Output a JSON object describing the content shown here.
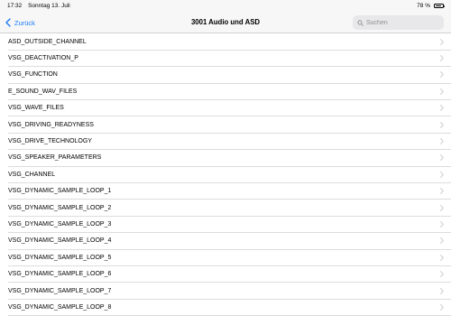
{
  "status": {
    "time": "17:32",
    "date": "Sonntag 13. Juli",
    "battery": "78 %",
    "battery_level": 0.78
  },
  "nav": {
    "back_label": "Zurück",
    "title": "3001 Audio und ASD",
    "search_placeholder": "Suchen"
  },
  "items": [
    "ASD_OUTSIDE_CHANNEL",
    "VSG_DEACTIVATION_P",
    "VSG_FUNCTION",
    "E_SOUND_WAV_FILES",
    "VSG_WAVE_FILES",
    "VSG_DRIVING_READYNESS",
    "VSG_DRIVE_TECHNOLOGY",
    "VSG_SPEAKER_PARAMETERS",
    "VSG_CHANNEL",
    "VSG_DYNAMIC_SAMPLE_LOOP_1",
    "VSG_DYNAMIC_SAMPLE_LOOP_2",
    "VSG_DYNAMIC_SAMPLE_LOOP_3",
    "VSG_DYNAMIC_SAMPLE_LOOP_4",
    "VSG_DYNAMIC_SAMPLE_LOOP_5",
    "VSG_DYNAMIC_SAMPLE_LOOP_6",
    "VSG_DYNAMIC_SAMPLE_LOOP_7",
    "VSG_DYNAMIC_SAMPLE_LOOP_8"
  ],
  "colors": {
    "accent": "#1a7cf5",
    "chevron": "#c4c4c7"
  }
}
